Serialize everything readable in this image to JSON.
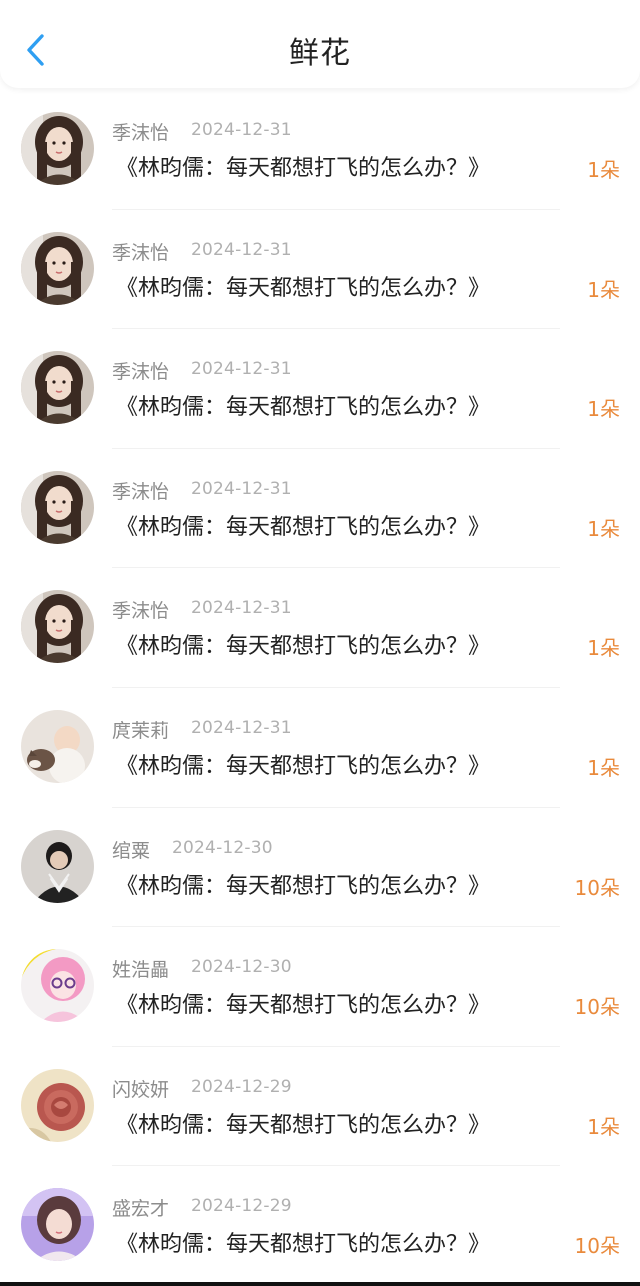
{
  "header": {
    "title": "鲜花",
    "back_icon": "chevron-left-icon",
    "accent_color": "#2f9ff2"
  },
  "colors": {
    "count": "#e98a3c",
    "name": "#8c8c8c",
    "date": "#b0b0b0",
    "book": "#222222"
  },
  "items": [
    {
      "name": "季沫怡",
      "date": "2024-12-31",
      "book": "《林昀儒：每天都想打飞的怎么办？》",
      "count": "1朵",
      "avatar": "avatar-girl-dark-hair"
    },
    {
      "name": "季沫怡",
      "date": "2024-12-31",
      "book": "《林昀儒：每天都想打飞的怎么办？》",
      "count": "1朵",
      "avatar": "avatar-girl-dark-hair"
    },
    {
      "name": "季沫怡",
      "date": "2024-12-31",
      "book": "《林昀儒：每天都想打飞的怎么办？》",
      "count": "1朵",
      "avatar": "avatar-girl-dark-hair"
    },
    {
      "name": "季沫怡",
      "date": "2024-12-31",
      "book": "《林昀儒：每天都想打飞的怎么办？》",
      "count": "1朵",
      "avatar": "avatar-girl-dark-hair"
    },
    {
      "name": "季沫怡",
      "date": "2024-12-31",
      "book": "《林昀儒：每天都想打飞的怎么办？》",
      "count": "1朵",
      "avatar": "avatar-girl-dark-hair"
    },
    {
      "name": "庹茉莉",
      "date": "2024-12-31",
      "book": "《林昀儒：每天都想打飞的怎么办？》",
      "count": "1朵",
      "avatar": "avatar-baby-dog"
    },
    {
      "name": "绾粟",
      "date": "2024-12-30",
      "book": "《林昀儒：每天都想打飞的怎么办？》",
      "count": "10朵",
      "avatar": "avatar-boy-sweater"
    },
    {
      "name": "姓浩畾",
      "date": "2024-12-30",
      "book": "《林昀儒：每天都想打飞的怎么办？》",
      "count": "10朵",
      "avatar": "avatar-anime-pink-hair"
    },
    {
      "name": "闪姣妍",
      "date": "2024-12-29",
      "book": "《林昀儒：每天都想打飞的怎么办？》",
      "count": "1朵",
      "avatar": "avatar-rose"
    },
    {
      "name": "盛宏才",
      "date": "2024-12-29",
      "book": "《林昀儒：每天都想打飞的怎么办？》",
      "count": "10朵",
      "avatar": "avatar-girl-purple"
    }
  ]
}
